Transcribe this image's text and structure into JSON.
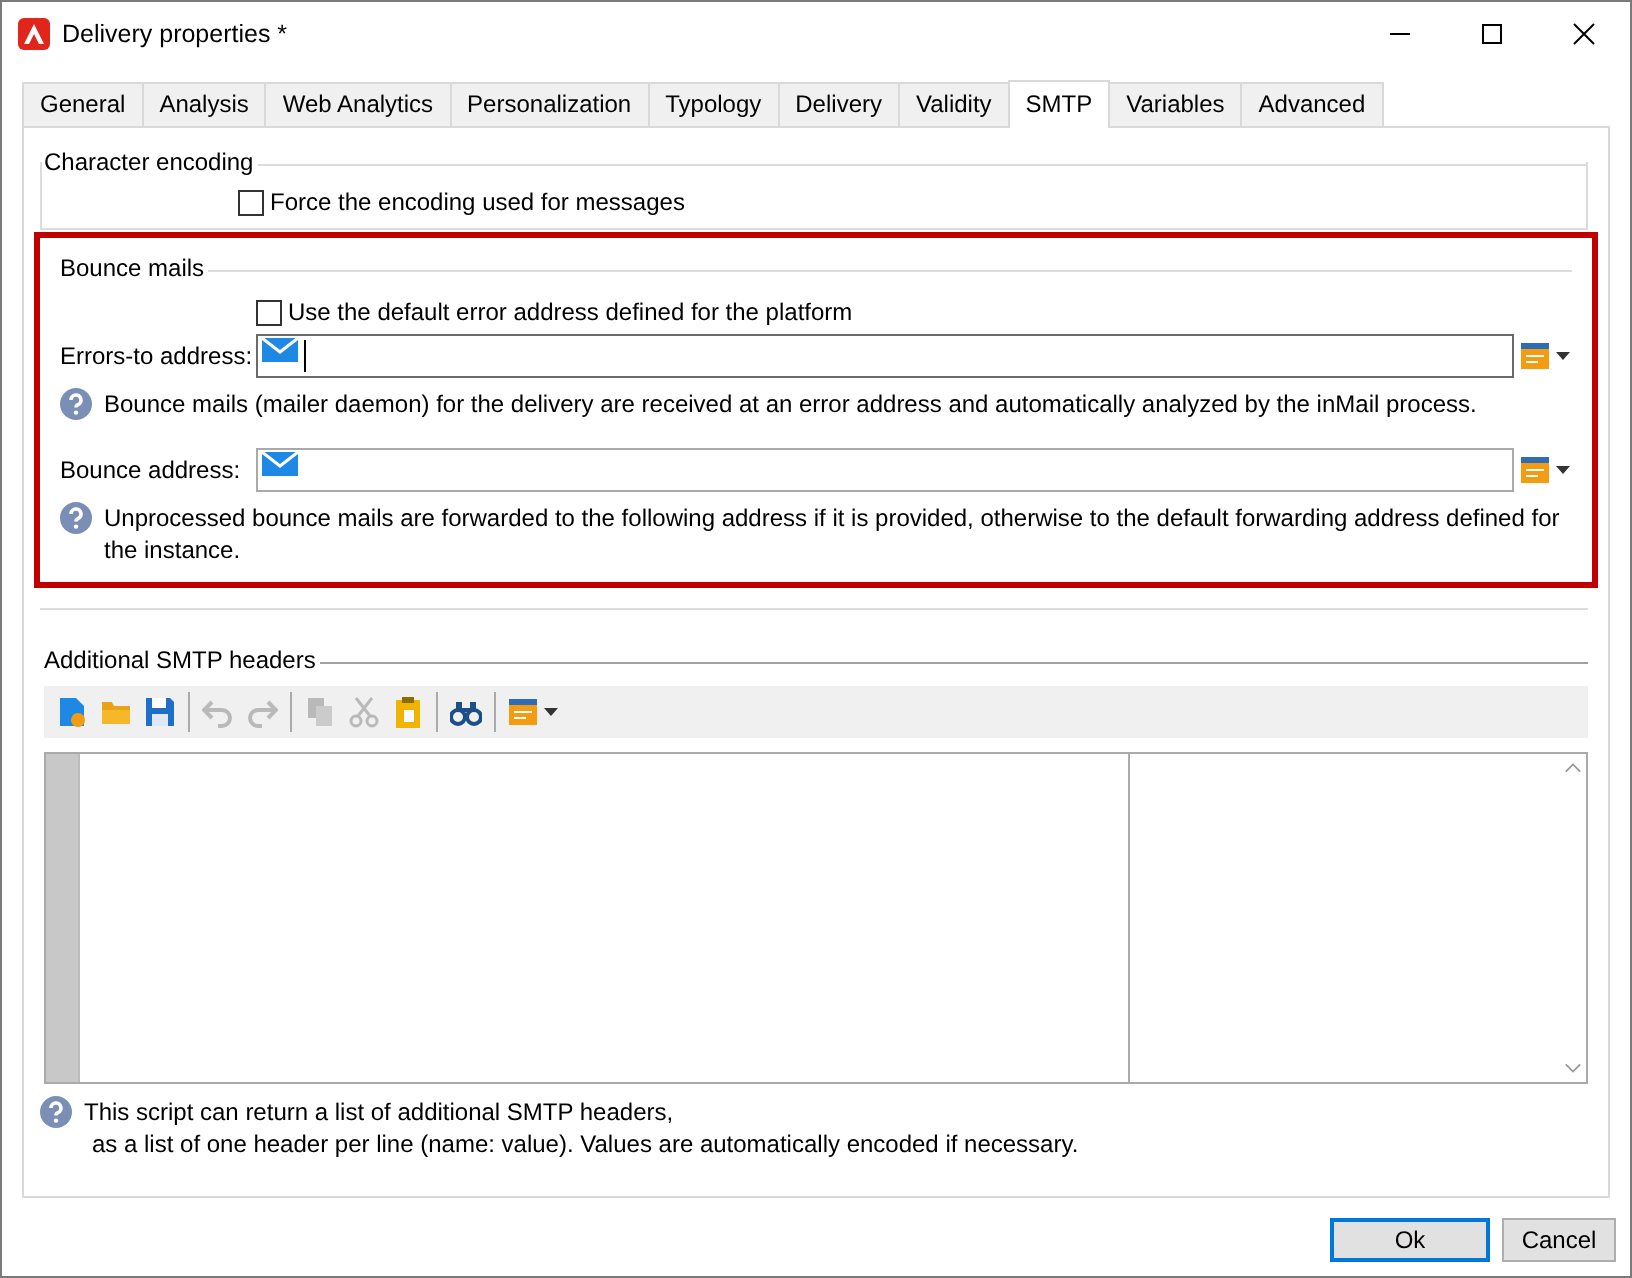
{
  "window": {
    "title": "Delivery properties *"
  },
  "tabs": [
    {
      "label": "General",
      "selected": false
    },
    {
      "label": "Analysis",
      "selected": false
    },
    {
      "label": "Web Analytics",
      "selected": false
    },
    {
      "label": "Personalization",
      "selected": false
    },
    {
      "label": "Typology",
      "selected": false
    },
    {
      "label": "Delivery",
      "selected": false
    },
    {
      "label": "Validity",
      "selected": false
    },
    {
      "label": "SMTP",
      "selected": true
    },
    {
      "label": "Variables",
      "selected": false
    },
    {
      "label": "Advanced",
      "selected": false
    }
  ],
  "character_encoding": {
    "title": "Character encoding",
    "checkbox": {
      "label": "Force the encoding used for messages",
      "checked": false
    }
  },
  "bounce_mails": {
    "title": "Bounce mails",
    "checkbox": {
      "label": "Use the default error address defined for the platform",
      "checked": false
    },
    "fields": [
      {
        "label": "Errors-to address:",
        "focused": true,
        "help": "Bounce mails (mailer daemon) for the delivery are received at an error address and automatically analyzed by the inMail process."
      },
      {
        "label": "Bounce address:",
        "focused": false,
        "help": "Unprocessed bounce mails are forwarded to the following address if it is provided, otherwise to the default forwarding address defined for the instance."
      }
    ]
  },
  "smtp_headers": {
    "title": "Additional SMTP headers",
    "toolbar": [
      {
        "kind": "new",
        "disabled": false
      },
      {
        "kind": "open",
        "disabled": false
      },
      {
        "kind": "save",
        "disabled": false
      },
      {
        "kind": "sep"
      },
      {
        "kind": "undo",
        "disabled": true
      },
      {
        "kind": "redo",
        "disabled": true
      },
      {
        "kind": "sep"
      },
      {
        "kind": "copy",
        "disabled": true
      },
      {
        "kind": "cut",
        "disabled": true
      },
      {
        "kind": "paste",
        "disabled": false
      },
      {
        "kind": "sep"
      },
      {
        "kind": "find",
        "disabled": false
      },
      {
        "kind": "sep"
      },
      {
        "kind": "menu",
        "disabled": false
      }
    ],
    "help": [
      "This script can return a list of additional SMTP headers,",
      "as a list of one header per line (name: value). Values are automatically encoded if necessary."
    ]
  },
  "buttons": [
    {
      "label": "Ok",
      "default": true
    },
    {
      "label": "Cancel",
      "default": false
    }
  ]
}
